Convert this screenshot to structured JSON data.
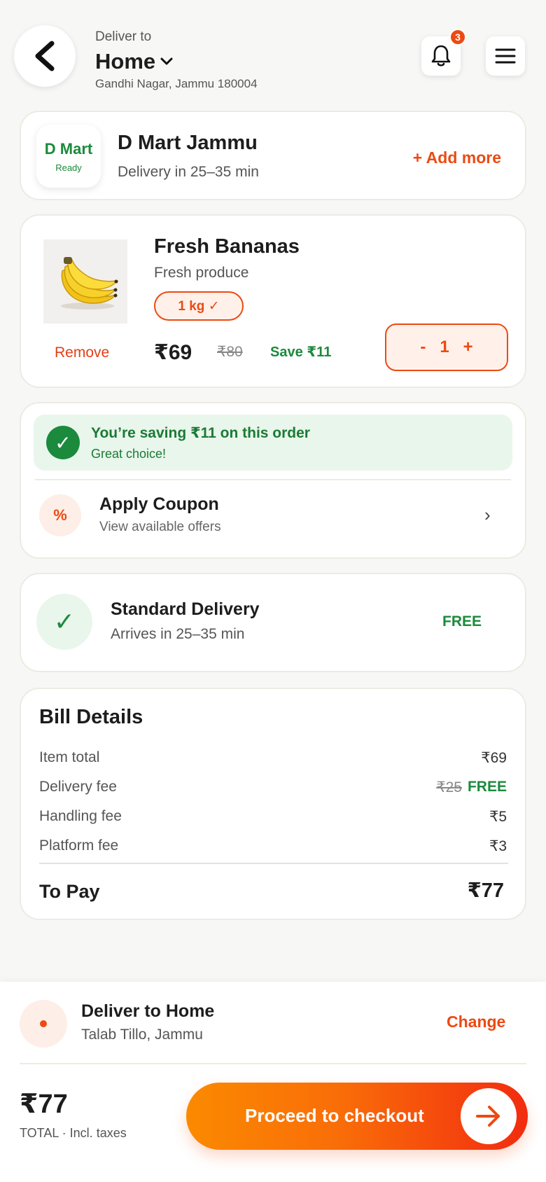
{
  "header": {
    "deliver_label": "Deliver to",
    "location_name": "Home",
    "address": "Gandhi Nagar, Jammu 180004",
    "notification_count": "3"
  },
  "store": {
    "logo_text": "D Mart",
    "logo_status": "Ready",
    "name": "D Mart Jammu",
    "eta": "Delivery in 25–35 min",
    "add_more_label": "+ Add more"
  },
  "item": {
    "name": "Fresh Bananas",
    "category": "Fresh produce",
    "weight": "1 kg ✓",
    "remove_label": "Remove",
    "price": "₹69",
    "mrp": "₹80",
    "save": "Save ₹11",
    "quantity": "1",
    "minus": "-",
    "plus": "+"
  },
  "savings": {
    "title": "You’re saving ₹11 on this order",
    "subtitle": "Great choice!"
  },
  "coupon": {
    "icon": "%",
    "title": "Apply Coupon",
    "subtitle": "View available offers",
    "chevron": "›"
  },
  "delivery": {
    "title": "Standard Delivery",
    "subtitle": "Arrives in 25–35 min",
    "fee": "FREE"
  },
  "bill": {
    "title": "Bill Details",
    "rows": [
      {
        "label": "Item total",
        "value": "₹69"
      },
      {
        "label": "Delivery fee",
        "old_value": "₹25",
        "value": "FREE"
      },
      {
        "label": "Handling fee",
        "value": "₹5"
      },
      {
        "label": "Platform fee",
        "value": "₹3"
      }
    ],
    "to_pay_label": "To Pay",
    "to_pay_value": "₹77"
  },
  "footer": {
    "address_title": "Deliver to Home",
    "address_sub": "Talab Tillo, Jammu",
    "change_label": "Change",
    "total": "₹77",
    "total_label": "TOTAL · Incl. taxes",
    "checkout_label": "Proceed to checkout"
  },
  "colors": {
    "accent": "#ec4a12",
    "success": "#1b8a3c",
    "background": "#f7f7f6"
  },
  "icons": [
    "back-arrow-icon",
    "chevron-down-icon",
    "bell-icon",
    "hamburger-menu-icon",
    "check-icon",
    "percent-icon",
    "chevron-right-icon",
    "location-dot-icon",
    "arrow-right-icon"
  ]
}
